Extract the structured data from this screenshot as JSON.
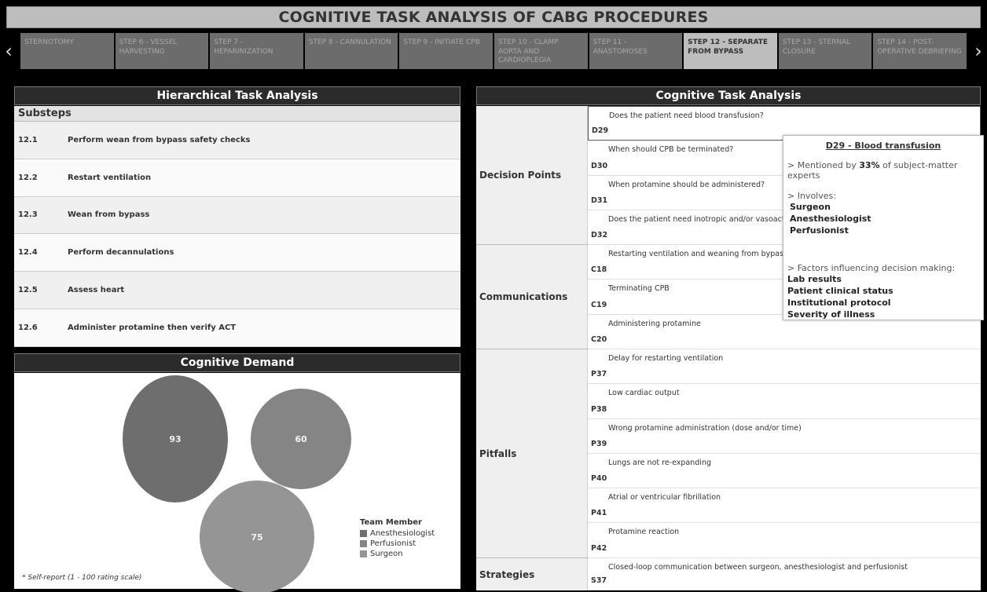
{
  "title": "COGNITIVE TASK ANALYSIS OF CABG PROCEDURES",
  "tabs": [
    {
      "label": "STERNOTOMY"
    },
    {
      "label": "STEP 6 - VESSEL HARVESTING"
    },
    {
      "label": "STEP 7 - HEPARINIZATION"
    },
    {
      "label": "STEP 8 - CANNULATION"
    },
    {
      "label": "STEP 9 - INITIATE CPB"
    },
    {
      "label": "STEP 10 - CLAMP AORTA AND CARDIOPLEGIA"
    },
    {
      "label": "STEP 11 - ANASTOMOSES"
    },
    {
      "label": "STEP 12 - SEPARATE FROM BYPASS"
    },
    {
      "label": "STEP 13 - STERNAL CLOSURE"
    },
    {
      "label": "STEP 14 - POST-OPERATIVE DEBRIEFING"
    }
  ],
  "active_tab": "STEP 12 - SEPARATE FROM BYPASS",
  "nav": {
    "left_icon": "chevron-left-icon",
    "right_icon": "chevron-right-icon"
  },
  "hta": {
    "heading": "Hierarchical Task Analysis",
    "substeps_label": "Substeps",
    "rows": [
      {
        "num": "12.1",
        "text": "Perform wean from bypass safety checks"
      },
      {
        "num": "12.2",
        "text": "Restart ventilation"
      },
      {
        "num": "12.3",
        "text": "Wean from bypass"
      },
      {
        "num": "12.4",
        "text": "Perform decannulations"
      },
      {
        "num": "12.5",
        "text": "Assess heart"
      },
      {
        "num": "12.6",
        "text": "Administer protamine then verify ACT"
      }
    ]
  },
  "cognitive_demand": {
    "heading": "Cognitive Demand",
    "bubbles": [
      {
        "member": "Anesthesiologist",
        "value": "93",
        "color": "#6e6e6e"
      },
      {
        "member": "Perfusionist",
        "value": "60",
        "color": "#858585"
      },
      {
        "member": "Surgeon",
        "value": "75",
        "color": "#959595"
      }
    ],
    "legend_title": "Team Member",
    "legend": [
      {
        "label": "Anesthesiologist",
        "color": "#6e6e6e"
      },
      {
        "label": "Perfusionist",
        "color": "#858585"
      },
      {
        "label": "Surgeon",
        "color": "#959595"
      }
    ],
    "footnote": "* Self-report (1 - 100 rating scale)"
  },
  "cta": {
    "heading": "Cognitive Task Analysis",
    "groups": [
      {
        "category": "Decision Points",
        "items": [
          {
            "code": "D29",
            "text": "Does the patient need blood transfusion?"
          },
          {
            "code": "D30",
            "text": "When should CPB be terminated?"
          },
          {
            "code": "D31",
            "text": "When protamine should be administered?"
          },
          {
            "code": "D32",
            "text": "Does the patient need inotropic and/or vasoacti"
          }
        ]
      },
      {
        "category": "Communications",
        "items": [
          {
            "code": "C18",
            "text": "Restarting ventilation and weaning from bypass"
          },
          {
            "code": "C19",
            "text": "Terminating CPB"
          },
          {
            "code": "C20",
            "text": "Administering protamine"
          }
        ]
      },
      {
        "category": "Pitfalls",
        "items": [
          {
            "code": "P37",
            "text": "Delay for restarting ventilation"
          },
          {
            "code": "P38",
            "text": "Low cardiac output"
          },
          {
            "code": "P39",
            "text": "Wrong protamine administration (dose and/or time)"
          },
          {
            "code": "P40",
            "text": "Lungs are not re-expanding"
          },
          {
            "code": "P41",
            "text": "Atrial or ventricular fibrillation"
          },
          {
            "code": "P42",
            "text": "Protamine reaction"
          }
        ]
      },
      {
        "category": "Strategies",
        "items": [
          {
            "code": "S37",
            "text": "Closed-loop communication between surgeon, anesthesiologist and perfusionist"
          }
        ]
      }
    ]
  },
  "tooltip": {
    "title": "D29 - Blood transfusion",
    "mentioned_prefix": "> Mentioned by ",
    "mentioned_pct": "33%",
    "mentioned_suffix": " of subject-matter experts",
    "involves_label": "> Involves:",
    "involves": [
      "Surgeon",
      "Anesthesiologist",
      "Perfusionist"
    ],
    "factors_label": "> Factors influencing decision making:",
    "factors": [
      "Lab results",
      "Patient clinical status",
      "Institutional protocol",
      "Severity of illness"
    ]
  }
}
